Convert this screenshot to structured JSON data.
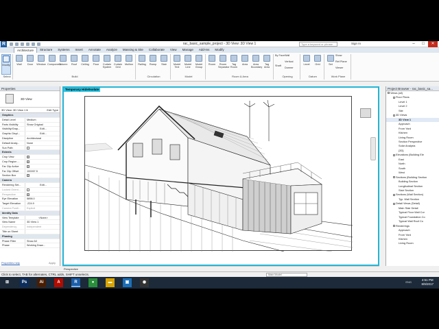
{
  "window": {
    "title": "rac_basic_sample_project - 3D View: 3D View 1",
    "search_placeholder": "Type a keyword or phrase",
    "sign_in": "Sign In",
    "logo": "R"
  },
  "tabs": [
    "Architecture",
    "Structure",
    "Systems",
    "Insert",
    "Annotate",
    "Analyze",
    "Massing & Site",
    "Collaborate",
    "View",
    "Manage",
    "Add-Ins",
    "Modify"
  ],
  "ribbon": {
    "modify": "Modify",
    "build": [
      "Wall",
      "Door",
      "Window",
      "Component",
      "Column",
      "Roof",
      "Ceiling",
      "Floor",
      "Curtain System",
      "Curtain Grid",
      "Mullion"
    ],
    "circulation": [
      "Railing",
      "Ramp",
      "Stair"
    ],
    "model": [
      "Model Text",
      "Model Line",
      "Model Group"
    ],
    "room": [
      "Room",
      "Room Separator",
      "Tag Room",
      "Area",
      "Area Boundary",
      "Tag Area"
    ],
    "opening": [
      "By Face",
      "Shaft",
      "Wall",
      "Vertical",
      "Dormer"
    ],
    "datum": [
      "Level",
      "Grid"
    ],
    "workplane": [
      "Set",
      "Show",
      "Ref Plane",
      "Viewer"
    ],
    "panels": {
      "select": "Select",
      "build": "Build",
      "circulation": "Circulation",
      "model": "Model",
      "room": "Room & Area",
      "opening": "Opening",
      "datum": "Datum",
      "workplane": "Work Plane"
    }
  },
  "properties": {
    "header": "Properties",
    "type": "3D View",
    "instance_selector": "3D View: 3D View 1",
    "edit_type": "Edit Type",
    "rows": [
      {
        "g": "Graphics"
      },
      {
        "k": "Detail Level",
        "v": "Medium"
      },
      {
        "k": "Parts Visibility",
        "v": "Show Original"
      },
      {
        "k": "Visibility/Grap...",
        "v": "Edit...",
        "btn": true
      },
      {
        "k": "Graphic Displ...",
        "v": "Edit...",
        "btn": true
      },
      {
        "k": "Discipline",
        "v": "Architectural"
      },
      {
        "k": "Default Analy...",
        "v": "None"
      },
      {
        "k": "Sun Path",
        "v": "",
        "chk": "off"
      },
      {
        "g": "Extents"
      },
      {
        "k": "Crop View",
        "v": "",
        "chk": "on"
      },
      {
        "k": "Crop Region ...",
        "v": "",
        "chk": "on"
      },
      {
        "k": "Far Clip Active",
        "v": "",
        "chk": "on"
      },
      {
        "k": "Far Clip Offset",
        "v": "100267.5"
      },
      {
        "k": "Section Box",
        "v": "",
        "chk": "on"
      },
      {
        "g": "Camera"
      },
      {
        "k": "Rendering Set...",
        "v": "Edit...",
        "btn": true
      },
      {
        "k": "Locked Orient...",
        "v": "",
        "chk": "off",
        "grey": true
      },
      {
        "k": "Perspective",
        "v": "",
        "chk": "on",
        "grey": true
      },
      {
        "k": "Eye Elevation",
        "v": "5898.0"
      },
      {
        "k": "Target Elevation",
        "v": "-224.9"
      },
      {
        "k": "Camera Positi...",
        "v": "Explicit",
        "grey": true
      },
      {
        "g": "Identity Data"
      },
      {
        "k": "View Template",
        "v": "<None>",
        "btn": true
      },
      {
        "k": "View Name",
        "v": "3D View 1"
      },
      {
        "k": "Dependency",
        "v": "Independent",
        "grey": true
      },
      {
        "k": "Title on Sheet",
        "v": ""
      },
      {
        "g": "Phasing"
      },
      {
        "k": "Phase Filter",
        "v": "Show All"
      },
      {
        "k": "Phase",
        "v": "Working Draw..."
      }
    ],
    "help": "Properties help",
    "apply": "Apply"
  },
  "viewport": {
    "badge": "Temporary Hide/Isolate",
    "view_control": "Perspective"
  },
  "browser": {
    "header": "Project Browser - rac_basic_sa...",
    "items": [
      {
        "t": "Views (all)",
        "d": 0,
        "e": "-"
      },
      {
        "t": "Floor Plans",
        "d": 1,
        "e": "-"
      },
      {
        "t": "Level 1",
        "d": 2
      },
      {
        "t": "Level 2",
        "d": 2
      },
      {
        "t": "Site",
        "d": 2
      },
      {
        "t": "3D Views",
        "d": 1,
        "e": "-"
      },
      {
        "t": "3D View 1",
        "d": 2,
        "sel": true
      },
      {
        "t": "Approach",
        "d": 2
      },
      {
        "t": "From Yard",
        "d": 2
      },
      {
        "t": "Kitchen",
        "d": 2
      },
      {
        "t": "Living Room",
        "d": 2
      },
      {
        "t": "Section Perspective",
        "d": 2
      },
      {
        "t": "Solar Analysis",
        "d": 2
      },
      {
        "t": "{3D}",
        "d": 2
      },
      {
        "t": "Elevations (Building Ele",
        "d": 1,
        "e": "-"
      },
      {
        "t": "East",
        "d": 2
      },
      {
        "t": "North",
        "d": 2
      },
      {
        "t": "South",
        "d": 2
      },
      {
        "t": "West",
        "d": 2
      },
      {
        "t": "Sections (Building Section",
        "d": 1,
        "e": "-"
      },
      {
        "t": "Building Section",
        "d": 2
      },
      {
        "t": "Longitudinal Section",
        "d": 2
      },
      {
        "t": "Stair Section",
        "d": 2
      },
      {
        "t": "Sections (Wall Section)",
        "d": 1,
        "e": "-"
      },
      {
        "t": "Typ. Wall Section",
        "d": 2
      },
      {
        "t": "Detail Views (Detail)",
        "d": 1,
        "e": "-"
      },
      {
        "t": "Main Stair Detail",
        "d": 2
      },
      {
        "t": "Typical Floor Wall Cor",
        "d": 2
      },
      {
        "t": "Typical Foundation Co",
        "d": 2
      },
      {
        "t": "Typical Wall Roof Co",
        "d": 2
      },
      {
        "t": "Renderings",
        "d": 1,
        "e": "-"
      },
      {
        "t": "Approach",
        "d": 2
      },
      {
        "t": "From Yard",
        "d": 2
      },
      {
        "t": "Kitchen",
        "d": 2
      },
      {
        "t": "Living Room",
        "d": 2
      }
    ]
  },
  "status": {
    "hint": "Click to select, TAB for alternates, CTRL adds, SHIFT unselects.",
    "model": "Main Model"
  },
  "taskbar": {
    "apps": [
      {
        "n": "start-icon",
        "g": "⊞"
      },
      {
        "n": "photoshop-icon",
        "g": "Ps",
        "c": "#0c2d5c"
      },
      {
        "n": "illustrator-icon",
        "g": "Ai",
        "c": "#4a1d00"
      },
      {
        "n": "acrobat-icon",
        "g": "A",
        "c": "#b30b00"
      },
      {
        "n": "revit-icon",
        "g": "R",
        "c": "#1b5da8",
        "active": true
      },
      {
        "n": "chrome-icon",
        "g": "●",
        "c": "#2a8f3b"
      },
      {
        "n": "file-explorer-icon",
        "g": "▬",
        "c": "#d9a400"
      },
      {
        "n": "photos-icon",
        "g": "▣",
        "c": "#1b6fb8"
      },
      {
        "n": "camera-app-icon",
        "g": "◉",
        "c": "#333"
      }
    ],
    "lang": "ENG",
    "time": "4:51 PM",
    "date": "8/9/2017"
  }
}
